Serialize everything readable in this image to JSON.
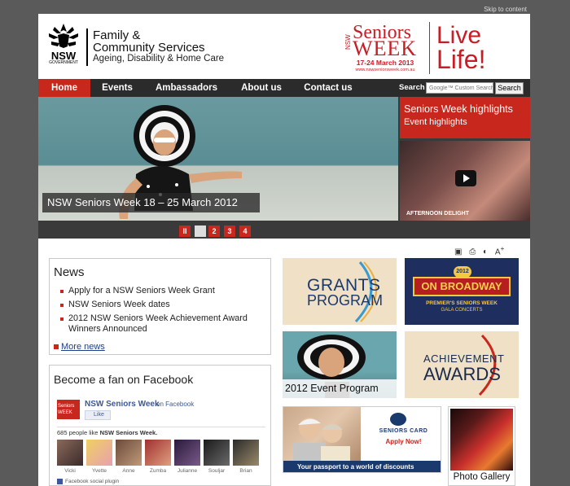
{
  "skip_link": "Skip to content",
  "header": {
    "gov_text": "NSW",
    "gov_subtext": "GOVERNMENT",
    "dept_line1": "Family &",
    "dept_line2": "Community Services",
    "dept_line3": "Ageing, Disability & Home Care",
    "seniors_week": {
      "nsw": "NSW",
      "seniors": "Seniors",
      "week": "WEEK",
      "dates": "17-24 March 2013",
      "url": "www.nswseniorsweek.com.au",
      "live": "Live",
      "life": "Life!"
    }
  },
  "nav": {
    "items": [
      "Home",
      "Events",
      "Ambassadors",
      "About us",
      "Contact us"
    ],
    "active": "Home",
    "search_label": "Search",
    "search_placeholder": "Google™ Custom Search",
    "search_button": "Search"
  },
  "hero": {
    "caption": "NSW Seniors Week 18 – 25 March 2012",
    "side_title": "Seniors Week highlights",
    "side_subtitle": "Event highlights",
    "video_caption": "AFTERNOON DELIGHT",
    "pager": [
      "II",
      "2",
      "3",
      "4"
    ]
  },
  "tools": {
    "icons": [
      "print-preview-icon",
      "print-icon",
      "contrast-icon",
      "text-size-icon"
    ]
  },
  "news": {
    "title": "News",
    "items": [
      "Apply for a NSW Seniors Week Grant",
      "NSW Seniors Week dates",
      "2012 NSW Seniors Week Achievement Award Winners Announced"
    ],
    "more": "More news"
  },
  "facebook": {
    "title": "Become a fan on Facebook",
    "logo_text": "Seniors WEEK",
    "page_name": "NSW Seniors Week",
    "on_facebook": "on Facebook",
    "like_button": "Like",
    "count_prefix": "685 people like",
    "count_page": "NSW Seniors Week.",
    "fans": [
      "Vicki",
      "Yvette",
      "Anne",
      "Zumba",
      "Julianne",
      "Souljar",
      "Brian"
    ],
    "plugin": "Facebook social plugin"
  },
  "promos": {
    "grants_line1": "GRANTS",
    "grants_line2": "PROGRAM",
    "broadway_year": "2012",
    "broadway_title": "ON BROADWAY",
    "broadway_sub1": "PREMIER'S SENIORS WEEK",
    "broadway_sub2": "GALA CONCERTS",
    "event_program": "2012 Event Program",
    "achieve_line1": "ACHIEVEMENT",
    "achieve_line2": "AWARDS",
    "seniors_card_brand": "SENIORS CARD",
    "seniors_card_apply": "Apply Now!",
    "seniors_card_tagline": "Your passport to a world of discounts",
    "photo_gallery": "Photo Gallery"
  },
  "colors": {
    "accent_red": "#c8271e",
    "nav_bg": "#2b2b2b",
    "page_bg": "#5a5a5a",
    "link_blue": "#1d3f8a"
  }
}
